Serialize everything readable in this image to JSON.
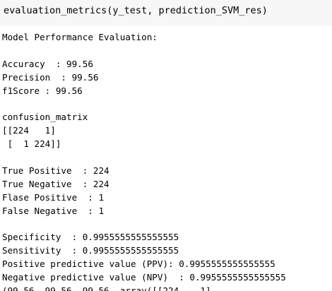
{
  "input": {
    "code": "evaluation_metrics(y_test, prediction_SVM_res)"
  },
  "output": {
    "heading": "Model Performance Evaluation:",
    "accuracy": "Accuracy  : 99.56",
    "precision": "Precision  : 99.56",
    "f1": "f1Score : 99.56",
    "cm_title": "confusion_matrix",
    "cm_row1": "[[224   1]",
    "cm_row2": " [  1 224]]",
    "tp": "True Positive  : 224",
    "tn": "True Negative  : 224",
    "fp": "Flase Positive  : 1",
    "fn": "False Negative  : 1",
    "specificity": "Specificity  : 0.9955555555555555",
    "sensitivity": "Sensitivity  : 0.9955555555555555",
    "ppv": "Positive predictive value (PPV): 0.9955555555555555",
    "npv": "Negative predictive value (NPV)  : 0.9955555555555555",
    "cut_line": "(99.56, 99.56, 99.56, array([[224,   1],"
  }
}
